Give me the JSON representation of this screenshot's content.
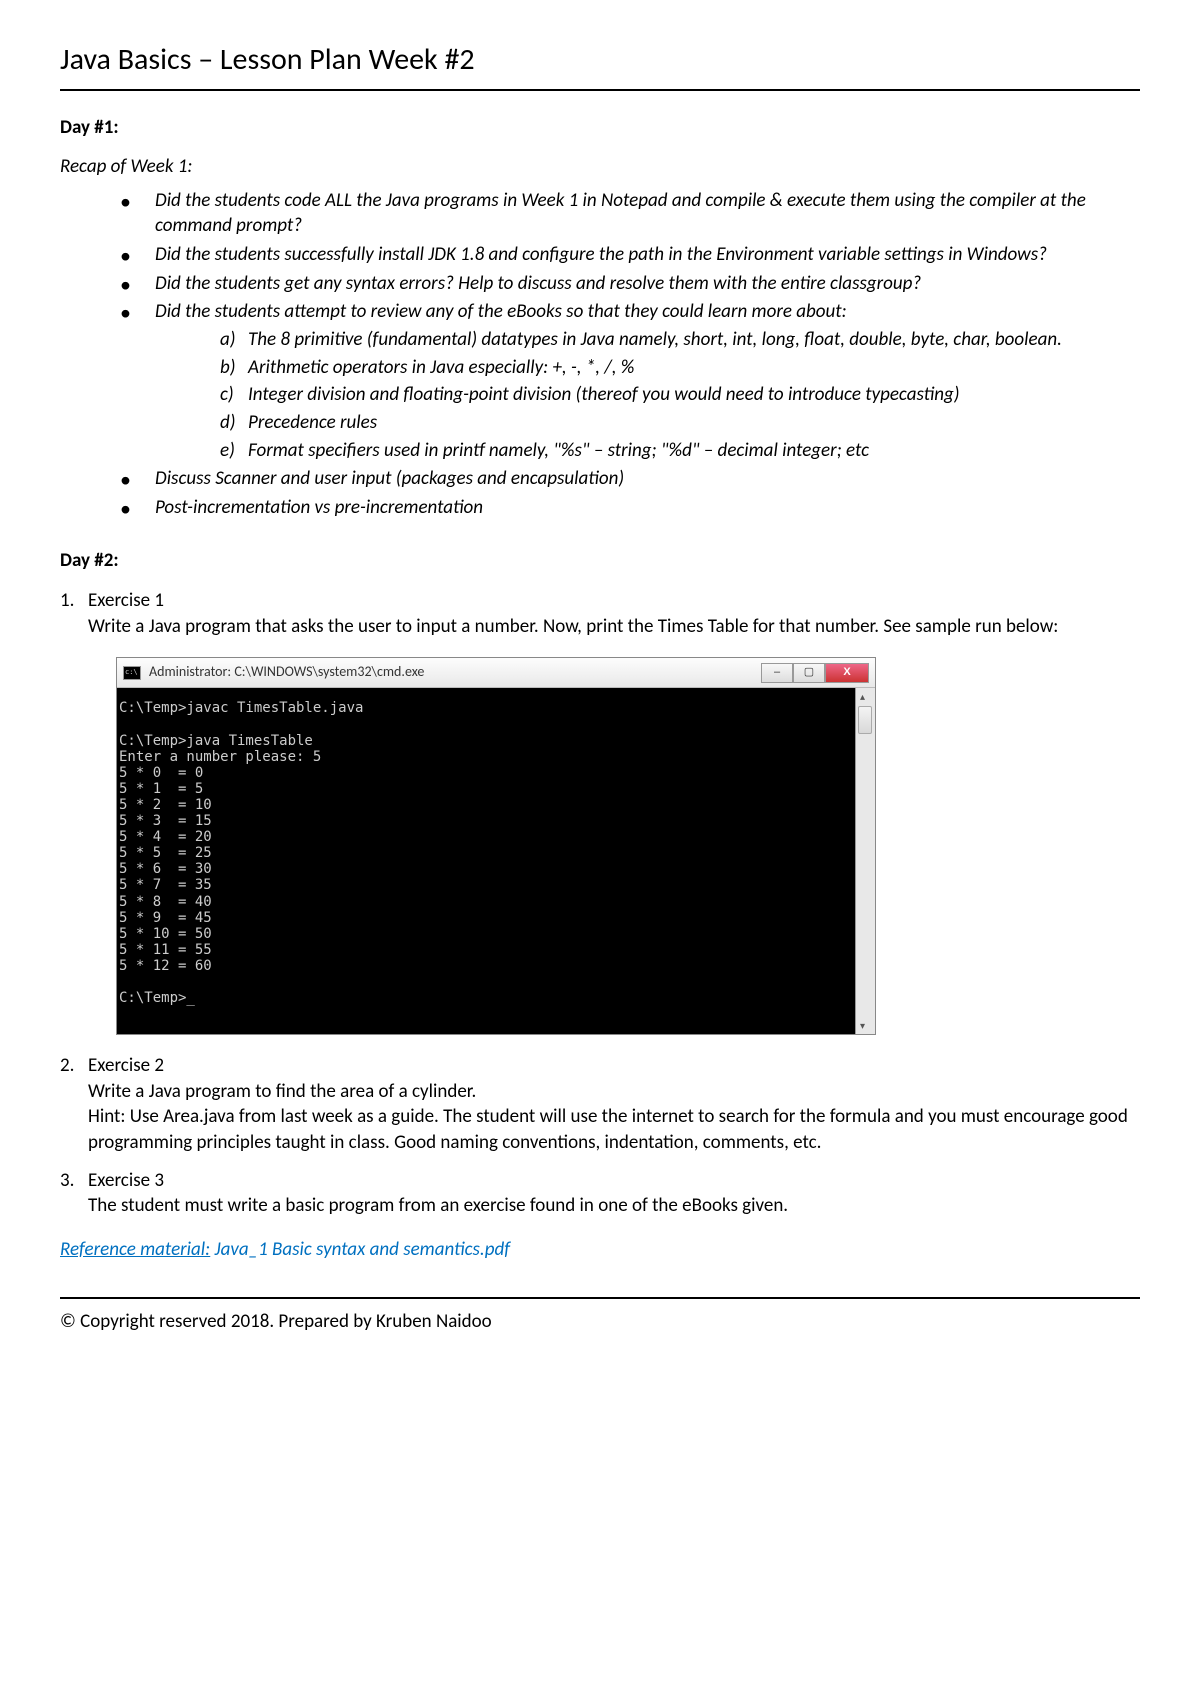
{
  "header": {
    "title": "Java Basics – Lesson Plan Week #2"
  },
  "day1": {
    "heading": "Day #1:",
    "recap_label": "Recap of Week 1:",
    "bullets": [
      "Did the students code ALL the Java programs in Week 1 in Notepad and compile & execute them using the compiler at the command prompt?",
      "Did the students successfully install JDK 1.8 and configure the path in the Environment variable settings in Windows?",
      "Did the students get any syntax errors? Help to discuss and resolve them with the entire classgroup?",
      "Did the students attempt to review any of the eBooks so that they could learn more about:"
    ],
    "letters": [
      "The 8 primitive (fundamental) datatypes in Java namely, short, int, long, float, double, byte, char, boolean.",
      "Arithmetic operators in Java especially: +, -, *, /, %",
      "Integer division and floating-point division (thereof you would need to introduce typecasting)",
      "Precedence rules",
      "Format specifiers used in printf namely, \"%s\" – string; \"%d\" – decimal integer; etc"
    ],
    "post_bullets": [
      "Discuss Scanner and user input (packages and encapsulation)",
      "Post-incrementation vs pre-incrementation"
    ]
  },
  "day2": {
    "heading": "Day #2:",
    "ex1": {
      "label": "Exercise 1",
      "text": "Write a Java program that asks the user to input a number. Now, print the Times Table for that number. See sample run below:"
    },
    "ex2": {
      "label": "Exercise 2",
      "text": "Write a Java program to find the area of a cylinder.\nHint: Use Area.java from last week as a guide. The student will use the internet to search for the formula and you must encourage good programming principles taught in class. Good naming conventions, indentation, comments, etc."
    },
    "ex3": {
      "label": "Exercise 3",
      "text": "The student must write a basic program from an exercise found in one of the eBooks given."
    }
  },
  "cmd": {
    "title": "Administrator: C:\\WINDOWS\\system32\\cmd.exe",
    "min_icon": "–",
    "max_icon": "▢",
    "close_icon": "X",
    "output": "C:\\Temp>javac TimesTable.java\n\nC:\\Temp>java TimesTable\nEnter a number please: 5\n5 * 0  = 0\n5 * 1  = 5\n5 * 2  = 10\n5 * 3  = 15\n5 * 4  = 20\n5 * 5  = 25\n5 * 6  = 30\n5 * 7  = 35\n5 * 8  = 40\n5 * 9  = 45\n5 * 10 = 50\n5 * 11 = 55\n5 * 12 = 60\n\nC:\\Temp>_"
  },
  "reference": {
    "prefix": "Reference material:",
    "file": " Java_1 Basic syntax and semantics.pdf"
  },
  "footer": {
    "text": "© Copyright reserved 2018. Prepared by Kruben Naidoo"
  }
}
